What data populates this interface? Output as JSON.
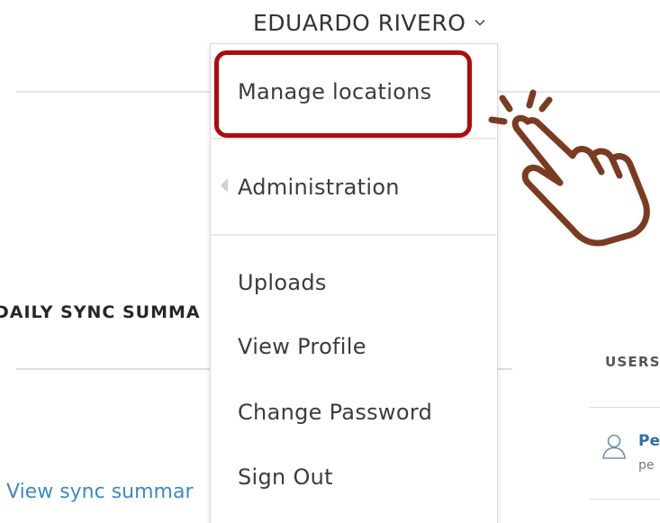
{
  "header": {
    "user_name": "EDUARDO RIVERO",
    "chevron_icon": "chevron-down-icon"
  },
  "dropdown": {
    "items": [
      {
        "label": "Manage locations"
      },
      {
        "label": "Administration"
      },
      {
        "label": "Uploads"
      },
      {
        "label": "View Profile"
      },
      {
        "label": "Change Password"
      },
      {
        "label": "Sign Out"
      }
    ],
    "highlight_color": "#b00a0a"
  },
  "background": {
    "daily_sync_title": "DAILY SYNC SUMMA",
    "view_sync_link": "View sync summar",
    "users_label": "USERS",
    "user_row": {
      "name": "Pe",
      "sub": "pe"
    }
  },
  "colors": {
    "link": "#3f88c5",
    "hand_stroke": "#7a3b20"
  }
}
